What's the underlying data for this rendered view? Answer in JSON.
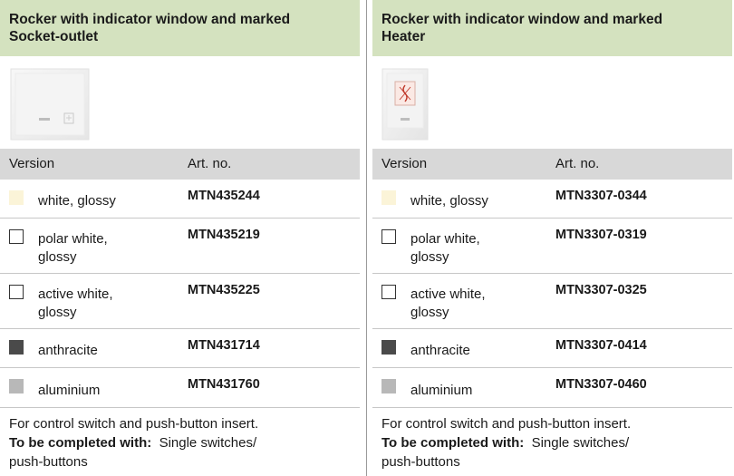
{
  "columns": [
    {
      "title_line1": "Rocker with indicator window and marked",
      "title_line2": "Socket-outlet",
      "photo": "socket-outlet-rocker-photo",
      "version_label": "Version",
      "artno_label": "Art. no.",
      "rows": [
        {
          "name1": "white, glossy",
          "name2": "",
          "art": "MTN435244",
          "swatch": "#fbf4d8",
          "border": "none"
        },
        {
          "name1": "polar white,",
          "name2": "glossy",
          "art": "MTN435219",
          "swatch": "#ffffff",
          "border": "#333333"
        },
        {
          "name1": "active white,",
          "name2": "glossy",
          "art": "MTN435225",
          "swatch": "#ffffff",
          "border": "#333333"
        },
        {
          "name1": "anthracite",
          "name2": "",
          "art": "MTN431714",
          "swatch": "#4a4a4a",
          "border": "none"
        },
        {
          "name1": "aluminium",
          "name2": "",
          "art": "MTN431760",
          "swatch": "#b8b8b8",
          "border": "none"
        }
      ],
      "footer_line1": "For control switch and push-button insert.",
      "footer_bold": "To be completed with:",
      "footer_line2_rest": "Single switches/",
      "footer_line3": "push-buttons"
    },
    {
      "title_line1": "Rocker with indicator window and marked",
      "title_line2": "Heater",
      "photo": "heater-rocker-photo",
      "version_label": "Version",
      "artno_label": "Art. no.",
      "rows": [
        {
          "name1": "white, glossy",
          "name2": "",
          "art": "MTN3307-0344",
          "swatch": "#fbf4d8",
          "border": "none"
        },
        {
          "name1": "polar white,",
          "name2": "glossy",
          "art": "MTN3307-0319",
          "swatch": "#ffffff",
          "border": "#333333"
        },
        {
          "name1": "active white,",
          "name2": "glossy",
          "art": "MTN3307-0325",
          "swatch": "#ffffff",
          "border": "#333333"
        },
        {
          "name1": "anthracite",
          "name2": "",
          "art": "MTN3307-0414",
          "swatch": "#4a4a4a",
          "border": "none"
        },
        {
          "name1": "aluminium",
          "name2": "",
          "art": "MTN3307-0460",
          "swatch": "#b8b8b8",
          "border": "none"
        }
      ],
      "footer_line1": "For control switch and push-button insert.",
      "footer_bold": "To be completed with:",
      "footer_line2_rest": "Single switches/",
      "footer_line3": "push-buttons"
    }
  ],
  "colors": {
    "header_bg": "#d4e2bf",
    "version_bar_bg": "#d8d8d8",
    "divider": "#9a9a9a"
  }
}
